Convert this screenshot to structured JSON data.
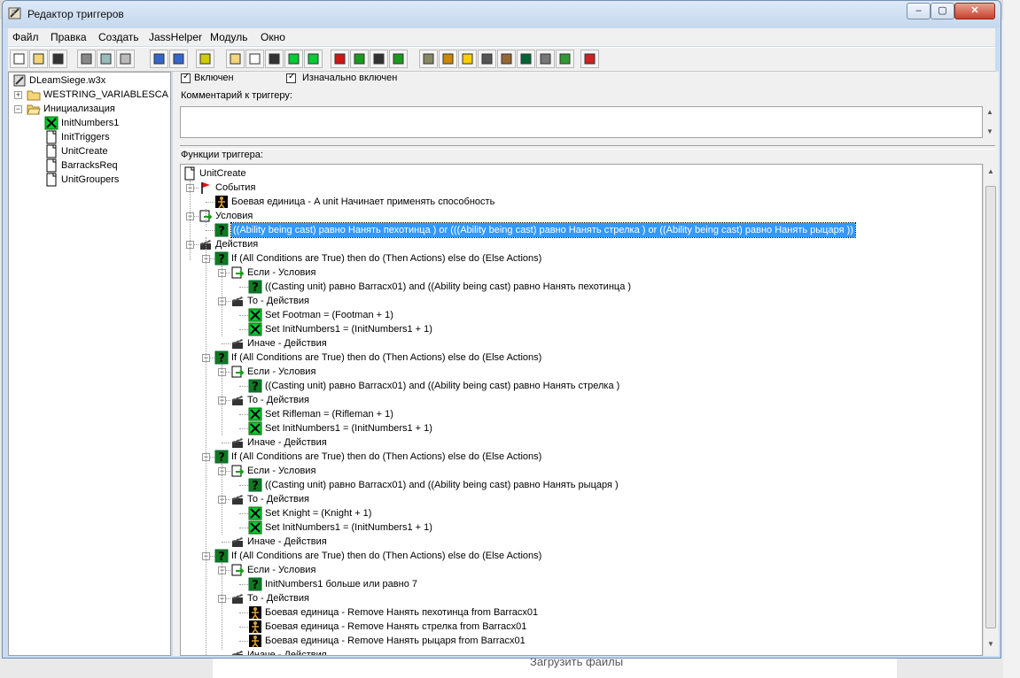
{
  "window": {
    "title": "Редактор триггеров"
  },
  "menu": [
    "Файл",
    "Правка",
    "Создать",
    "JassHelper",
    "Модуль",
    "Окно"
  ],
  "toolbar_icons": [
    "new-icon",
    "open-icon",
    "save-icon",
    "cut-icon",
    "copy-icon",
    "paste-icon",
    "undo-icon",
    "redo-icon",
    "close-x-icon",
    "folder-icon",
    "document-icon",
    "comment-icon",
    "variable-icon",
    "variable-x-icon",
    "event-flag-icon",
    "condition-icon",
    "action-icon",
    "checklist-icon",
    "terrain-icon",
    "object-icon",
    "sound-icon",
    "camera-icon",
    "import-icon",
    "ai-icon",
    "object-box-icon",
    "campaign-icon",
    "test-map-icon"
  ],
  "left_tree": {
    "root": "DLeamSiege.w3x",
    "items": [
      {
        "label": "WESTRING_VARIABLESCA",
        "type": "folder",
        "level": 1
      },
      {
        "label": "Инициализация",
        "type": "folder-open",
        "level": 1
      },
      {
        "label": "InitNumbers1",
        "type": "variable",
        "level": 2
      },
      {
        "label": "InitTriggers",
        "type": "trigger",
        "level": 2
      },
      {
        "label": "UnitCreate",
        "type": "trigger",
        "level": 2
      },
      {
        "label": "BarracksReq",
        "type": "trigger",
        "level": 2
      },
      {
        "label": "UnitGroupers",
        "type": "trigger",
        "level": 2
      }
    ]
  },
  "trigger": {
    "enabled_label": "Включен",
    "initially_on_label": "Изначально включен",
    "comment_label": "Комментарий к триггеру:",
    "functions_label": "Функции триггера:"
  },
  "functions": [
    {
      "level": 0,
      "type": "trigger",
      "label": "UnitCreate"
    },
    {
      "level": 1,
      "type": "event",
      "label": "События",
      "toggle": "-"
    },
    {
      "level": 2,
      "type": "unit",
      "label": "Боевая единица - A unit Начинает применять способность"
    },
    {
      "level": 1,
      "type": "condition",
      "label": "Условия",
      "toggle": "-"
    },
    {
      "level": 2,
      "type": "question",
      "label": "((Ability being cast) равно Нанять пехотинца ) or (((Ability being cast) равно Нанять стрелка ) or ((Ability being cast) равно Нанять рыцаря ))",
      "selected": true
    },
    {
      "level": 1,
      "type": "action",
      "label": "Действия",
      "toggle": "-"
    },
    {
      "level": 2,
      "type": "question",
      "label": "If (All Conditions are True) then do (Then Actions) else do (Else Actions)",
      "toggle": "-"
    },
    {
      "level": 3,
      "type": "condition",
      "label": "Если - Условия",
      "toggle": "-"
    },
    {
      "level": 4,
      "type": "question",
      "label": "((Casting unit) равно Barracx01) and ((Ability being cast) равно Нанять пехотинца )"
    },
    {
      "level": 3,
      "type": "action",
      "label": "То - Действия",
      "toggle": "-"
    },
    {
      "level": 4,
      "type": "setvar",
      "label": "Set Footman = (Footman + 1)"
    },
    {
      "level": 4,
      "type": "setvar",
      "label": "Set InitNumbers1 = (InitNumbers1 + 1)"
    },
    {
      "level": 3,
      "type": "action",
      "label": "Иначе - Действия"
    },
    {
      "level": 2,
      "type": "question",
      "label": "If (All Conditions are True) then do (Then Actions) else do (Else Actions)",
      "toggle": "-"
    },
    {
      "level": 3,
      "type": "condition",
      "label": "Если - Условия",
      "toggle": "-"
    },
    {
      "level": 4,
      "type": "question",
      "label": "((Casting unit) равно Barracx01) and ((Ability being cast) равно Нанять стрелка )"
    },
    {
      "level": 3,
      "type": "action",
      "label": "То - Действия",
      "toggle": "-"
    },
    {
      "level": 4,
      "type": "setvar",
      "label": "Set Rifleman = (Rifleman + 1)"
    },
    {
      "level": 4,
      "type": "setvar",
      "label": "Set InitNumbers1 = (InitNumbers1 + 1)"
    },
    {
      "level": 3,
      "type": "action",
      "label": "Иначе - Действия"
    },
    {
      "level": 2,
      "type": "question",
      "label": "If (All Conditions are True) then do (Then Actions) else do (Else Actions)",
      "toggle": "-"
    },
    {
      "level": 3,
      "type": "condition",
      "label": "Если - Условия",
      "toggle": "-"
    },
    {
      "level": 4,
      "type": "question",
      "label": "((Casting unit) равно Barracx01) and ((Ability being cast) равно Нанять рыцаря )"
    },
    {
      "level": 3,
      "type": "action",
      "label": "То - Действия",
      "toggle": "-"
    },
    {
      "level": 4,
      "type": "setvar",
      "label": "Set Knight = (Knight + 1)"
    },
    {
      "level": 4,
      "type": "setvar",
      "label": "Set InitNumbers1 = (InitNumbers1 + 1)"
    },
    {
      "level": 3,
      "type": "action",
      "label": "Иначе - Действия"
    },
    {
      "level": 2,
      "type": "question",
      "label": "If (All Conditions are True) then do (Then Actions) else do (Else Actions)",
      "toggle": "-"
    },
    {
      "level": 3,
      "type": "condition",
      "label": "Если - Условия",
      "toggle": "-"
    },
    {
      "level": 4,
      "type": "question",
      "label": "InitNumbers1 больше или равно 7"
    },
    {
      "level": 3,
      "type": "action",
      "label": "То - Действия",
      "toggle": "-"
    },
    {
      "level": 4,
      "type": "unit",
      "label": "Боевая единица - Remove Нанять пехотинца  from Barracx01"
    },
    {
      "level": 4,
      "type": "unit",
      "label": "Боевая единица - Remove Нанять стрелка  from Barracx01"
    },
    {
      "level": 4,
      "type": "unit",
      "label": "Боевая единица - Remove Нанять рыцаря  from Barracx01"
    },
    {
      "level": 3,
      "type": "action",
      "label": "Иначе - Действия"
    }
  ],
  "background_page": {
    "upload_text": "Загрузить файлы"
  }
}
